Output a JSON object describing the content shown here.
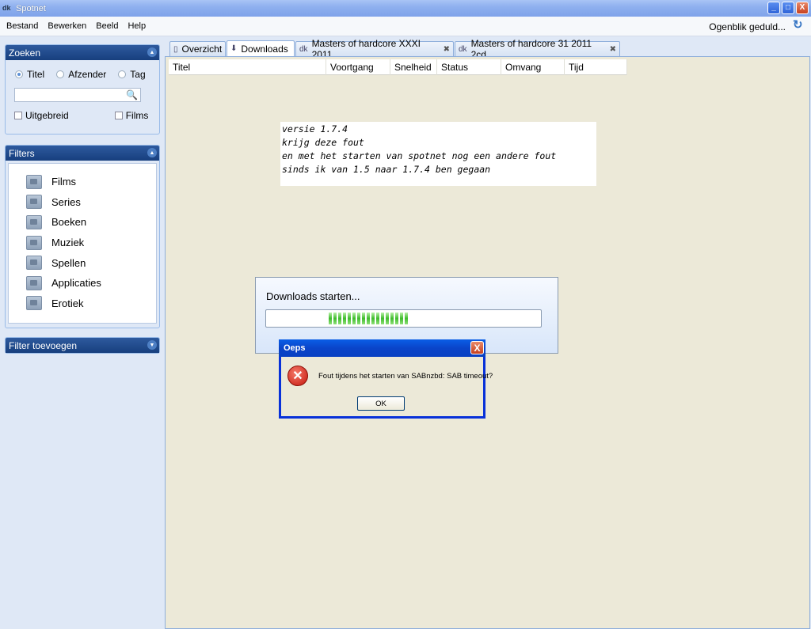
{
  "window": {
    "title": "Spotnet",
    "minimize": "_",
    "maximize": "□",
    "close": "X"
  },
  "menu": {
    "items": [
      {
        "label": "Bestand"
      },
      {
        "label": "Bewerken"
      },
      {
        "label": "Beeld"
      },
      {
        "label": "Help"
      }
    ],
    "busy_text": "Ogenblik geduld...",
    "refresh_icon": "refresh-icon"
  },
  "search": {
    "header": "Zoeken",
    "radios": [
      {
        "label": "Titel",
        "checked": true
      },
      {
        "label": "Afzender",
        "checked": false
      },
      {
        "label": "Tag",
        "checked": false
      }
    ],
    "input_value": "",
    "checkboxes": [
      {
        "label": "Uitgebreid",
        "checked": false
      },
      {
        "label": "Films",
        "checked": false
      }
    ]
  },
  "filters": {
    "header": "Filters",
    "items": [
      {
        "label": "Films"
      },
      {
        "label": "Series"
      },
      {
        "label": "Boeken"
      },
      {
        "label": "Muziek"
      },
      {
        "label": "Spellen"
      },
      {
        "label": "Applicaties"
      },
      {
        "label": "Erotiek"
      }
    ]
  },
  "add_filter": {
    "header": "Filter toevoegen"
  },
  "tabs": [
    {
      "label": "Overzicht",
      "closable": false
    },
    {
      "label": "Downloads",
      "closable": false,
      "active": true
    },
    {
      "label": "Masters of hardcore XXXI 2011",
      "closable": true
    },
    {
      "label": "Masters of hardcore 31 2011 2cd",
      "closable": true
    }
  ],
  "grid": {
    "columns": [
      "Titel",
      "Voortgang",
      "Snelheid",
      "Status",
      "Omvang",
      "Tijd"
    ]
  },
  "note": {
    "lines": [
      "versie 1.7.4",
      "krijg deze fout",
      "en met het starten van spotnet nog een andere fout",
      "sinds ik van 1.5 naar 1.7.4 ben gegaan"
    ]
  },
  "download_box": {
    "title": "Downloads starten...",
    "progress_segments": 17
  },
  "error_dialog": {
    "title": "Oeps",
    "close": "X",
    "icon": "error-icon",
    "message": "Fout tijdens het starten van SABnzbd: SAB timeout?",
    "ok_label": "OK"
  },
  "colors": {
    "panel_header": "#173f7e",
    "dialog_border": "#0831d9",
    "progress_green": "#3ebc2c"
  }
}
